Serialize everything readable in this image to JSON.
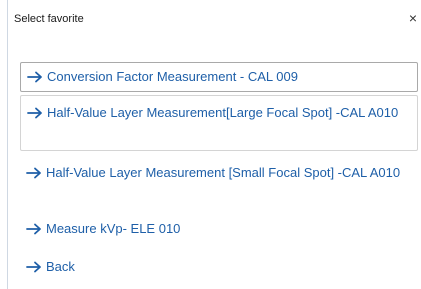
{
  "dialog": {
    "title": "Select favorite",
    "close_glyph": "×"
  },
  "items": [
    {
      "label": "Conversion Factor Measurement - CAL 009",
      "icon": "arrow-right-icon"
    },
    {
      "label": "Half-Value Layer Measurement[Large Focal Spot] -CAL A010",
      "icon": "arrow-right-icon"
    },
    {
      "label": "Half-Value Layer Measurement [Small Focal Spot] -CAL A010",
      "icon": "arrow-right-icon"
    },
    {
      "label": "Measure kVp- ELE 010",
      "icon": "arrow-right-icon"
    },
    {
      "label": "Back",
      "icon": "arrow-right-icon"
    }
  ],
  "colors": {
    "link": "#1e5fa8",
    "selected_border": "#a9a9a9",
    "pressed_border": "#d4d4d4"
  }
}
